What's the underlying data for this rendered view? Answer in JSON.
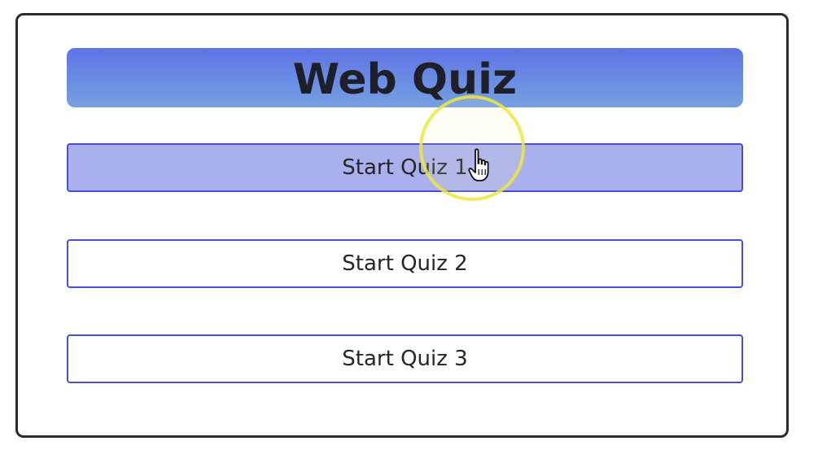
{
  "app": {
    "title": "Web Quiz"
  },
  "buttons": [
    {
      "label": "Start Quiz 1",
      "state": "hovered"
    },
    {
      "label": "Start Quiz 2",
      "state": "normal"
    },
    {
      "label": "Start Quiz 3",
      "state": "normal"
    }
  ],
  "cursor": {
    "icon": "hand-pointer-icon",
    "highlight": "yellow-click-highlight"
  },
  "colors": {
    "banner_top": "#5f73e6",
    "banner_bottom": "#779fe0",
    "button_border": "#4a4cd8",
    "button_hover_bg": "#aab0ee",
    "highlight": "#ece83c"
  }
}
